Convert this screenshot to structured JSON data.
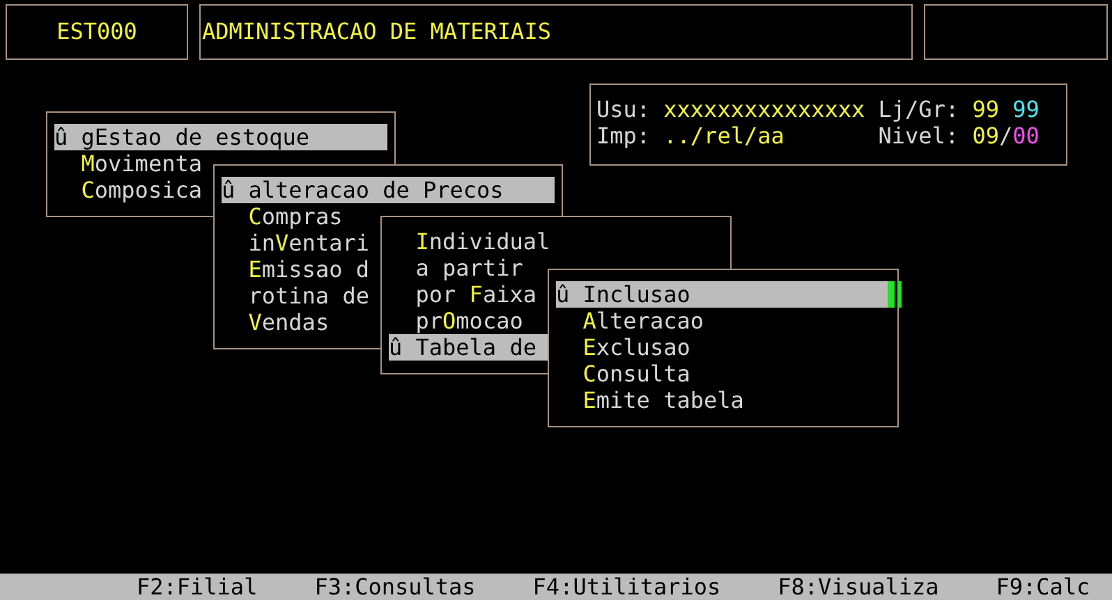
{
  "header": {
    "program_code": "EST000",
    "title": "ADMINISTRACAO DE MATERIAIS"
  },
  "info_panel": {
    "user_label": "Usu:",
    "user_value": "xxxxxxxxxxxxxxx",
    "store_label": "Lj/Gr:",
    "store_values": [
      {
        "text": "99",
        "color": "#f2f23c"
      },
      {
        "text": "99",
        "color": "#4ee8ee"
      }
    ],
    "printer_label": "Imp:",
    "printer_value": "../rel/aa",
    "level_label": "Nivel:",
    "level_separator": "/",
    "level_values": [
      {
        "text": "09",
        "color": "#f2f23c"
      },
      {
        "text": "00",
        "color": "#ee4eee"
      }
    ]
  },
  "menus": [
    {
      "marker": "û",
      "items": [
        {
          "selected": true,
          "parts": [
            {
              "text": "gEstao de estoque",
              "hotkey": false
            }
          ]
        },
        {
          "selected": false,
          "parts": [
            {
              "text": "M",
              "hotkey": true
            },
            {
              "text": "ovimenta",
              "hotkey": false
            }
          ]
        },
        {
          "selected": false,
          "parts": [
            {
              "text": "C",
              "hotkey": true
            },
            {
              "text": "omposica",
              "hotkey": false
            }
          ]
        }
      ]
    },
    {
      "marker": "û",
      "items": [
        {
          "selected": true,
          "parts": [
            {
              "text": "alteracao de Precos",
              "hotkey": false
            }
          ]
        },
        {
          "selected": false,
          "parts": [
            {
              "text": "C",
              "hotkey": true
            },
            {
              "text": "ompras",
              "hotkey": false
            }
          ]
        },
        {
          "selected": false,
          "parts": [
            {
              "text": "in",
              "hotkey": false
            },
            {
              "text": "V",
              "hotkey": true
            },
            {
              "text": "entari",
              "hotkey": false
            }
          ]
        },
        {
          "selected": false,
          "parts": [
            {
              "text": "E",
              "hotkey": true
            },
            {
              "text": "missao d",
              "hotkey": false
            }
          ]
        },
        {
          "selected": false,
          "parts": [
            {
              "text": "rotina de",
              "hotkey": false
            }
          ]
        },
        {
          "selected": false,
          "parts": [
            {
              "text": "V",
              "hotkey": true
            },
            {
              "text": "endas",
              "hotkey": false
            }
          ]
        }
      ]
    },
    {
      "marker": "û",
      "items": [
        {
          "selected": false,
          "parts": [
            {
              "text": "I",
              "hotkey": true
            },
            {
              "text": "ndividual",
              "hotkey": false
            }
          ]
        },
        {
          "selected": false,
          "parts": [
            {
              "text": "a partir",
              "hotkey": false
            }
          ]
        },
        {
          "selected": false,
          "parts": [
            {
              "text": "por ",
              "hotkey": false
            },
            {
              "text": "F",
              "hotkey": true
            },
            {
              "text": "aixa",
              "hotkey": false
            }
          ]
        },
        {
          "selected": false,
          "parts": [
            {
              "text": "pr",
              "hotkey": false
            },
            {
              "text": "O",
              "hotkey": true
            },
            {
              "text": "mocao",
              "hotkey": false
            }
          ]
        },
        {
          "selected": true,
          "parts": [
            {
              "text": "Tabela de",
              "hotkey": false
            }
          ]
        }
      ]
    },
    {
      "marker": "û",
      "items": [
        {
          "selected": true,
          "parts": [
            {
              "text": "Inclusao",
              "hotkey": false
            }
          ]
        },
        {
          "selected": false,
          "parts": [
            {
              "text": "A",
              "hotkey": true
            },
            {
              "text": "lteracao",
              "hotkey": false
            }
          ]
        },
        {
          "selected": false,
          "parts": [
            {
              "text": "E",
              "hotkey": true
            },
            {
              "text": "xclusao",
              "hotkey": false
            }
          ]
        },
        {
          "selected": false,
          "parts": [
            {
              "text": "C",
              "hotkey": true
            },
            {
              "text": "onsulta",
              "hotkey": false
            }
          ]
        },
        {
          "selected": false,
          "parts": [
            {
              "text": "E",
              "hotkey": true
            },
            {
              "text": "mite tabela",
              "hotkey": false
            }
          ]
        }
      ]
    }
  ],
  "function_keys": [
    "F2:Filial",
    "F3:Consultas",
    "F4:Utilitarios",
    "F8:Visualiza",
    "F9:Calc"
  ]
}
